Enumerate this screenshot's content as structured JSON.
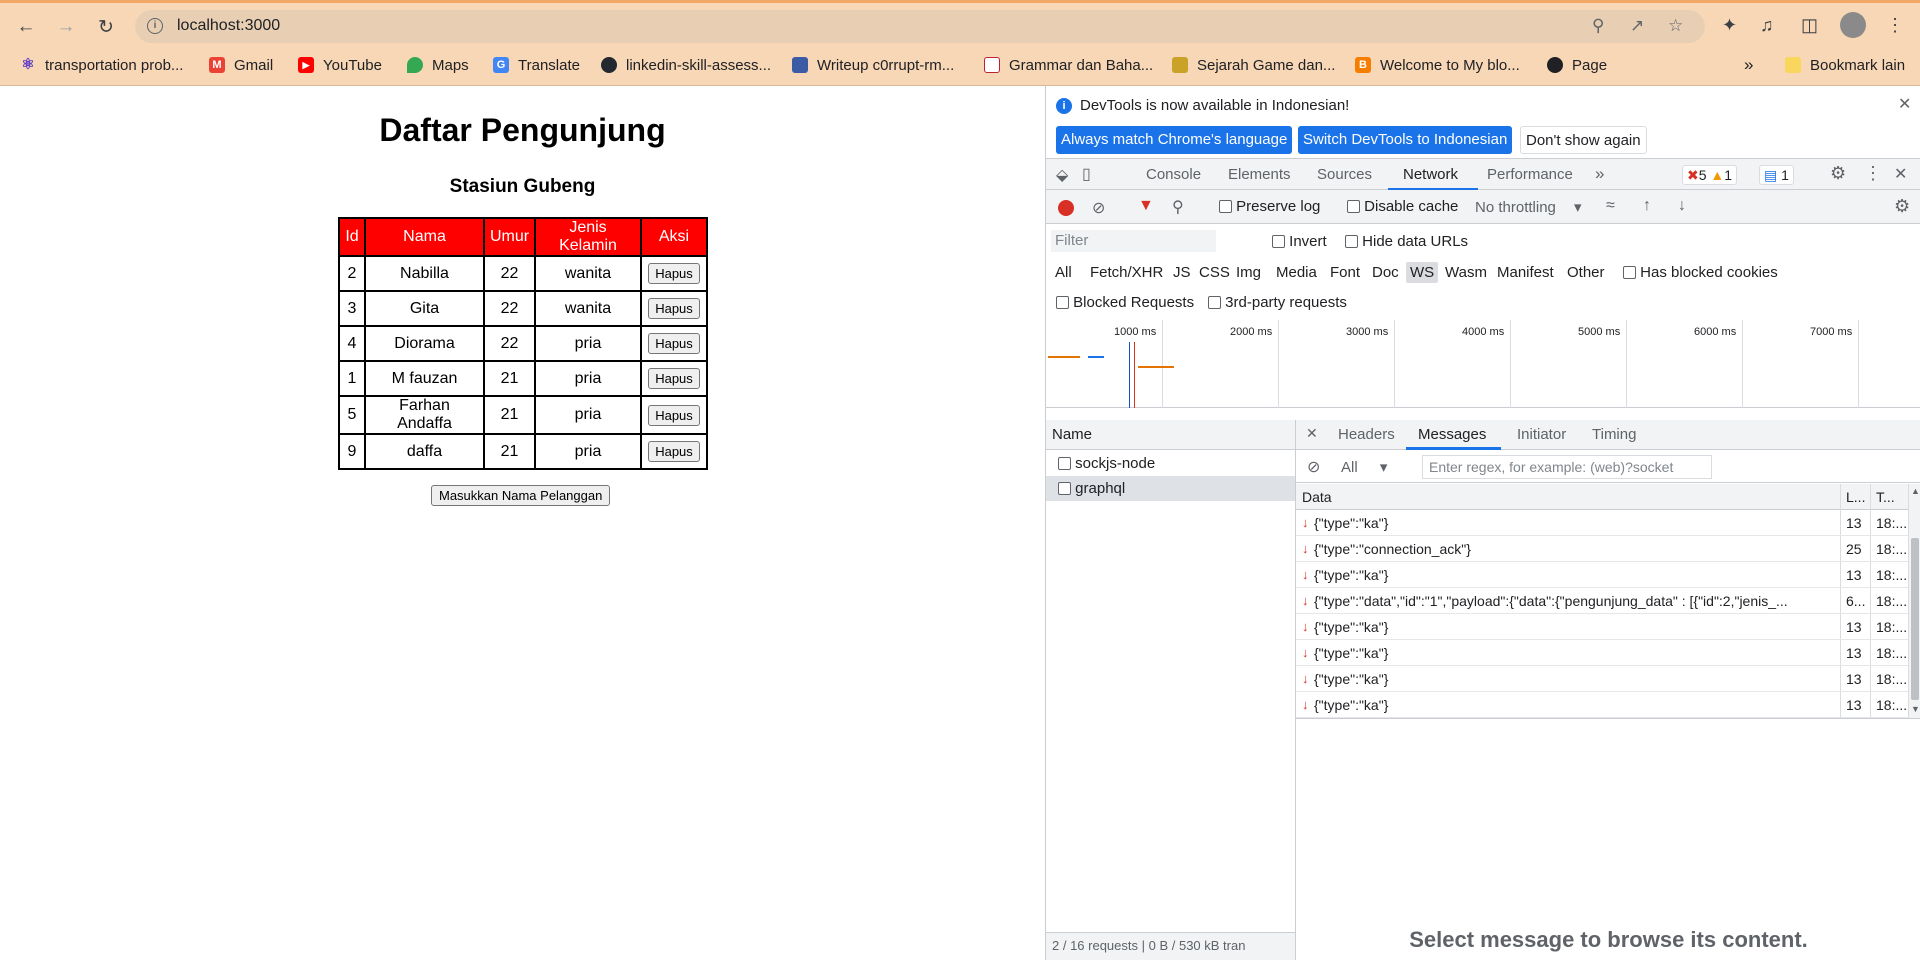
{
  "browser": {
    "url": "localhost:3000",
    "bookmarks": [
      {
        "label": "transportation prob...",
        "icon": "atom-icon"
      },
      {
        "label": "Gmail",
        "icon": "gmail-icon"
      },
      {
        "label": "YouTube",
        "icon": "youtube-icon"
      },
      {
        "label": "Maps",
        "icon": "maps-icon"
      },
      {
        "label": "Translate",
        "icon": "translate-icon"
      },
      {
        "label": "linkedin-skill-assess...",
        "icon": "github-icon"
      },
      {
        "label": "Writeup c0rrupt-rm...",
        "icon": "writeup-icon"
      },
      {
        "label": "Grammar dan Baha...",
        "icon": "grammar-icon"
      },
      {
        "label": "Sejarah Game dan...",
        "icon": "game-icon"
      },
      {
        "label": "Welcome to My blo...",
        "icon": "blogger-icon"
      },
      {
        "label": "Page",
        "icon": "page-icon"
      }
    ],
    "more_bookmarks": "»",
    "other_bookmarks": "Bookmark lain"
  },
  "page": {
    "title": "Daftar Pengunjung",
    "subtitle": "Stasiun Gubeng",
    "table": {
      "headers": [
        "Id",
        "Nama",
        "Umur",
        "Jenis Kelamin",
        "Aksi"
      ],
      "rows": [
        {
          "id": "2",
          "nama": "Nabilla",
          "umur": "22",
          "jenis_kelamin": "wanita",
          "aksi": "Hapus"
        },
        {
          "id": "3",
          "nama": "Gita",
          "umur": "22",
          "jenis_kelamin": "wanita",
          "aksi": "Hapus"
        },
        {
          "id": "4",
          "nama": "Diorama",
          "umur": "22",
          "jenis_kelamin": "pria",
          "aksi": "Hapus"
        },
        {
          "id": "1",
          "nama": "M fauzan",
          "umur": "21",
          "jenis_kelamin": "pria",
          "aksi": "Hapus"
        },
        {
          "id": "5",
          "nama": "Farhan Andaffa",
          "umur": "21",
          "jenis_kelamin": "pria",
          "aksi": "Hapus"
        },
        {
          "id": "9",
          "nama": "daffa",
          "umur": "21",
          "jenis_kelamin": "pria",
          "aksi": "Hapus"
        }
      ]
    },
    "add_button": "Masukkan Nama Pelanggan"
  },
  "devtools": {
    "banner": {
      "text": "DevTools is now available in Indonesian!",
      "btn_match": "Always match Chrome's language",
      "btn_switch": "Switch DevTools to Indonesian",
      "btn_dismiss": "Don't show again"
    },
    "tabs": [
      "Console",
      "Elements",
      "Sources",
      "Network",
      "Performance"
    ],
    "active_tab": "Network",
    "more_tabs": "»",
    "error_count": "5",
    "warning_count": "1",
    "info_count": "1",
    "network": {
      "preserve_log": "Preserve log",
      "disable_cache": "Disable cache",
      "throttling": "No throttling",
      "filter_placeholder": "Filter",
      "invert": "Invert",
      "hide_data_urls": "Hide data URLs",
      "type_filters": [
        "All",
        "Fetch/XHR",
        "JS",
        "CSS",
        "Img",
        "Media",
        "Font",
        "Doc",
        "WS",
        "Wasm",
        "Manifest",
        "Other"
      ],
      "active_type": "WS",
      "has_blocked_cookies": "Has blocked cookies",
      "blocked_requests": "Blocked Requests",
      "third_party": "3rd-party requests",
      "timeline_ticks": [
        "1000 ms",
        "2000 ms",
        "3000 ms",
        "4000 ms",
        "5000 ms",
        "6000 ms",
        "7000 ms"
      ],
      "name_header": "Name",
      "requests": [
        "sockjs-node",
        "graphql"
      ],
      "selected_request": "graphql",
      "status_bar": "2 / 16 requests",
      "status_transferred": "0 B / 530 kB tran"
    },
    "detail": {
      "tabs": [
        "Headers",
        "Messages",
        "Initiator",
        "Timing"
      ],
      "active_tab": "Messages",
      "filter_select": "All",
      "regex_placeholder": "Enter regex, for example: (web)?socket",
      "columns": {
        "data": "Data",
        "length": "L...",
        "time": "T..."
      },
      "messages": [
        {
          "data": "{\"type\":\"ka\"}",
          "length": "13",
          "time": "18:..."
        },
        {
          "data": "{\"type\":\"connection_ack\"}",
          "length": "25",
          "time": "18:..."
        },
        {
          "data": "{\"type\":\"ka\"}",
          "length": "13",
          "time": "18:..."
        },
        {
          "data": "{\"type\":\"data\",\"id\":\"1\",\"payload\":{\"data\":{\"pengunjung_data\" : [{\"id\":2,\"jenis_...",
          "length": "6...",
          "time": "18:..."
        },
        {
          "data": "{\"type\":\"ka\"}",
          "length": "13",
          "time": "18:..."
        },
        {
          "data": "{\"type\":\"ka\"}",
          "length": "13",
          "time": "18:..."
        },
        {
          "data": "{\"type\":\"ka\"}",
          "length": "13",
          "time": "18:..."
        },
        {
          "data": "{\"type\":\"ka\"}",
          "length": "13",
          "time": "18:..."
        }
      ],
      "empty_hint": "Select message to browse its content."
    }
  },
  "colors": {
    "chrome_bg": "#f8d7b6",
    "table_header": "#ff0000",
    "devtools_accent": "#1a73e8",
    "incoming_arrow": "#d93025"
  }
}
